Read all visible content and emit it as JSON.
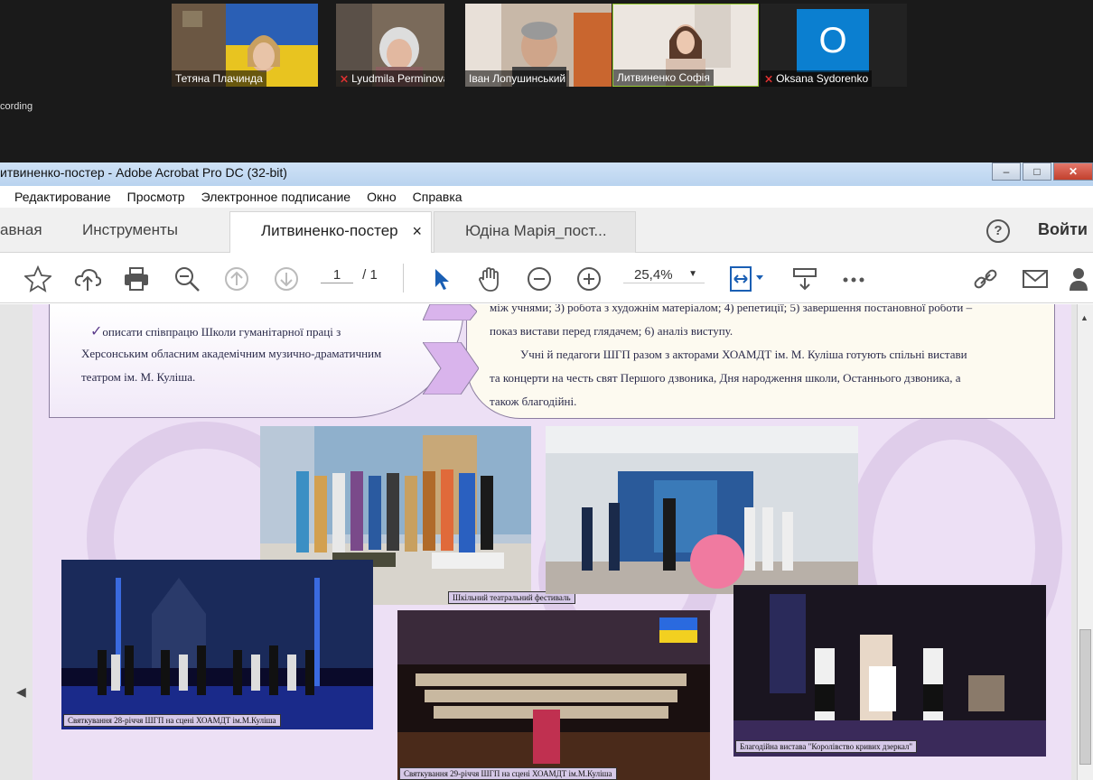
{
  "zoom": {
    "participants": [
      {
        "name": "Тетяна Плачинда",
        "muted": false
      },
      {
        "name": "Lyudmila Perminova",
        "muted": true
      },
      {
        "name": "Іван Лопушинський",
        "muted": false
      },
      {
        "name": "Литвиненко Софія",
        "muted": false
      },
      {
        "name": "Oksana Sydorenko",
        "muted": true,
        "initial": "O"
      }
    ],
    "recording_text": "cording"
  },
  "window": {
    "title": "итвиненко-постер - Adobe Acrobat Pro DC (32-bit)",
    "min": "–",
    "max": "□",
    "close": "✕"
  },
  "menu": [
    "Редактирование",
    "Просмотр",
    "Электронное подписание",
    "Окно",
    "Справка"
  ],
  "tabs": {
    "home": "авная",
    "tools": "Инструменты",
    "doc_active": "Литвиненко-постер",
    "doc_other": "Юдіна Марія_пост...",
    "close_symbol": "×",
    "help": "?",
    "login": "Войти"
  },
  "toolbar": {
    "page_current": "1",
    "page_total": "/ 1",
    "zoom": "25,4%"
  },
  "poster": {
    "left_text": {
      "line1": "описати співпрацю Школи гуманітарної праці з",
      "line2": "Херсонським обласним академічним музично-драматичним",
      "line3": "театром ім. М. Куліша."
    },
    "right_text": {
      "line1": "між учнями; 3) робота з художнім матеріалом; 4) репетиції; 5) завершення постановної роботи –",
      "line2": "показ вистави перед глядачем; 6) аналіз виступу.",
      "line3": "Учні й педагоги ШГП разом з акторами ХОАМДТ ім. М. Куліша готують спільні вистави",
      "line4": "та концерти на честь свят Першого дзвоника, Дня народження школи, Останнього дзвоника, а",
      "line5": "також   благодійні."
    },
    "captions": {
      "festival": "Шкільний театральний фестиваль",
      "anniv28": "Святкування 28-річчя ШГП на сцені ХОАМДТ ім.М.Куліша",
      "anniv29": "Святкування 29-річчя ШГП на сцені ХОАМДТ ім.М.Куліша",
      "charity": "Благодійна вистава \"Королівство кривих дзеркал\""
    }
  },
  "colors": {
    "poster_bg": "#ede0f5",
    "chevron": "#d9b4ec",
    "zoom_bg": "#1a1a1a"
  }
}
